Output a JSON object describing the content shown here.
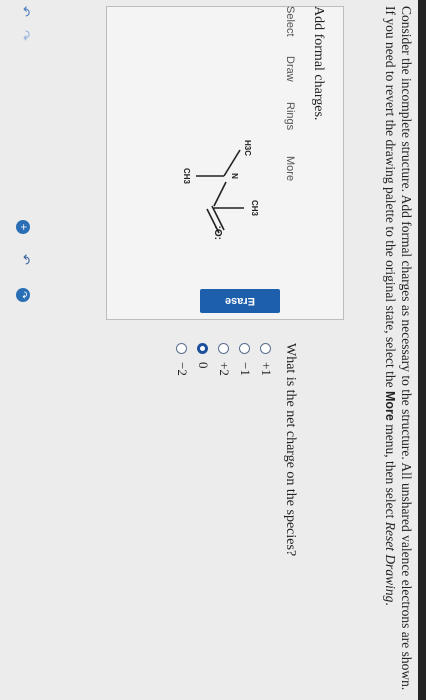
{
  "question": {
    "intro_line1": "Consider the incomplete structure. Add formal charges as necessary to the structure. All unshared valence electrons are shown.",
    "intro_line2_a": "If you need to revert the drawing palette to the original state, select the",
    "intro_line2_more": "More",
    "intro_line2_b": "menu, then select",
    "intro_line2_reset": "Reset Drawing",
    "intro_line2_c": "."
  },
  "drawing": {
    "task_label": "Add formal charges.",
    "tools": [
      "Select",
      "Draw",
      "Rings",
      "More"
    ],
    "erase_label": "Erase",
    "molecule": {
      "atoms": {
        "n": "N",
        "o": ":O:",
        "h3c": "H3C",
        "ch3_right": "CH3",
        "ch3_bottom": "CH3"
      }
    }
  },
  "net_charge": {
    "question": "What is the net charge on the species?",
    "options": [
      "+1",
      "−1",
      "+2",
      "0",
      "−2"
    ],
    "selected": "0"
  },
  "icons": [
    "zoom-in-icon",
    "undo-icon",
    "redo-icon",
    "back-icon",
    "forward-icon"
  ],
  "colors": {
    "accent": "#1d5faa",
    "radio": "#1d4f9a"
  }
}
